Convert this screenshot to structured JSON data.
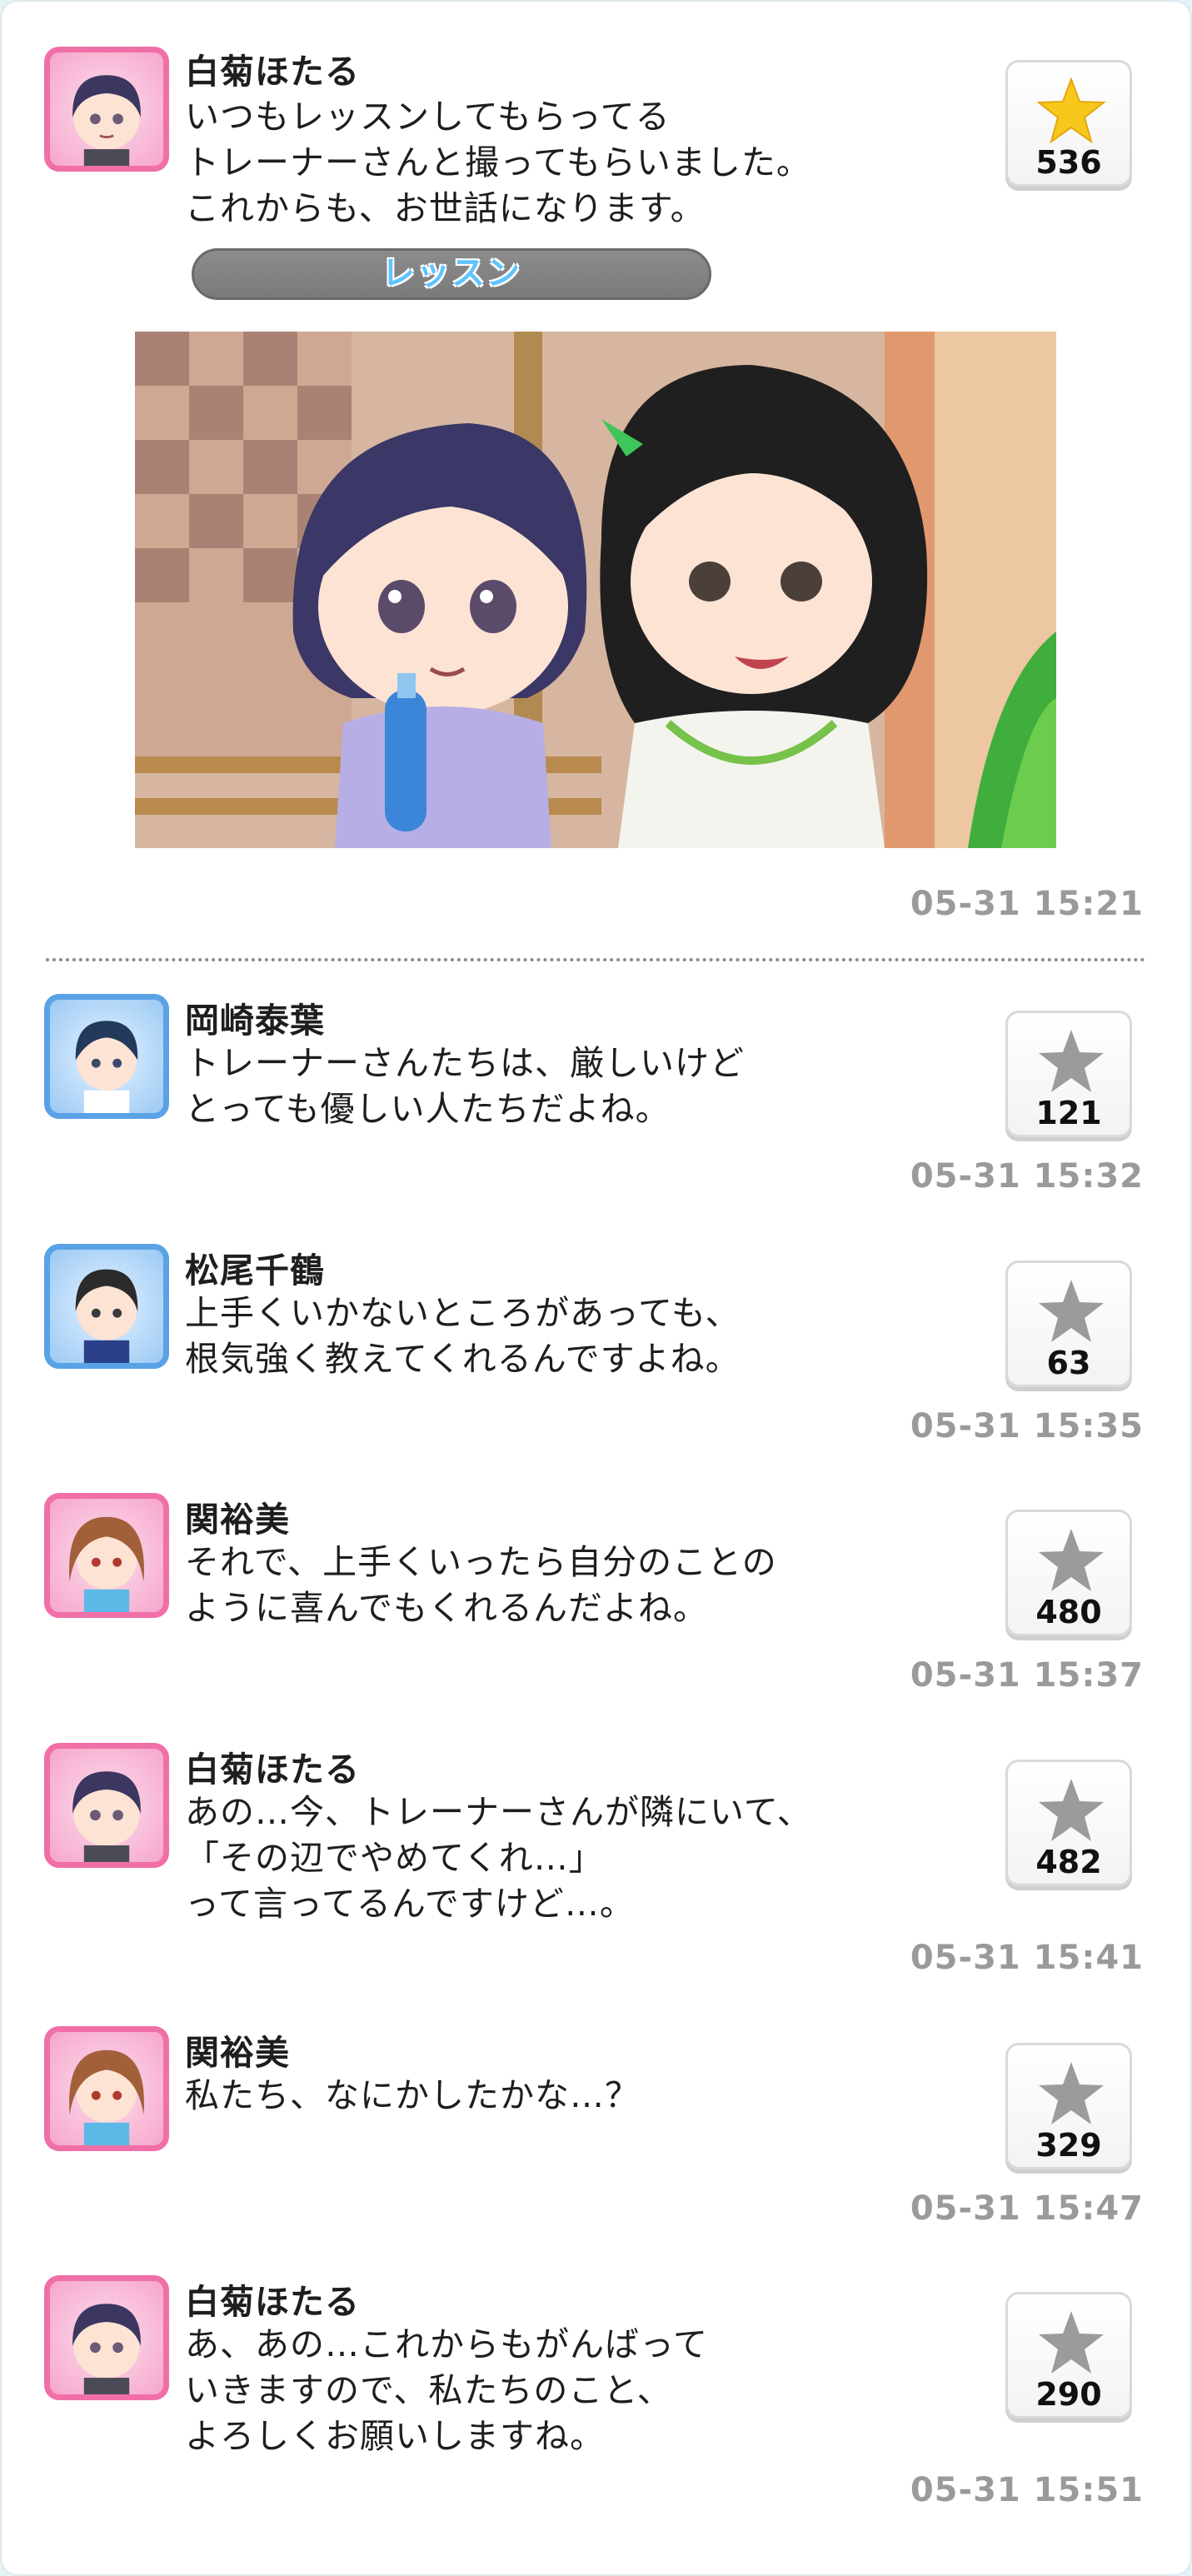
{
  "posts": [
    {
      "author": "白菊ほたる",
      "text": "いつもレッスンしてもらってる\nトレーナーさんと撮ってもらいました。\nこれからも、お世話になります。",
      "tag": "レッスン",
      "likes": "536",
      "liked": true,
      "time": "05-31 15:21"
    },
    {
      "author": "岡崎泰葉",
      "text": "トレーナーさんたちは、厳しいけど\nとっても優しい人たちだよね。",
      "likes": "121",
      "liked": false,
      "time": "05-31 15:32"
    },
    {
      "author": "松尾千鶴",
      "text": "上手くいかないところがあっても、\n根気強く教えてくれるんですよね。",
      "likes": "63",
      "liked": false,
      "time": "05-31 15:35"
    },
    {
      "author": "関裕美",
      "text": "それで、上手くいったら自分のことの\nように喜んでもくれるんだよね。",
      "likes": "480",
      "liked": false,
      "time": "05-31 15:37"
    },
    {
      "author": "白菊ほたる",
      "text": "あの…今、トレーナーさんが隣にいて、\n「その辺でやめてくれ…」\nって言ってるんですけど…。",
      "likes": "482",
      "liked": false,
      "time": "05-31 15:41"
    },
    {
      "author": "関裕美",
      "text": "私たち、なにかしたかな…？",
      "likes": "329",
      "liked": false,
      "time": "05-31 15:47"
    },
    {
      "author": "白菊ほたる",
      "text": "あ、あの…これからもがんばって\nいきますので、私たちのこと、\nよろしくお願いしますね。",
      "likes": "290",
      "liked": false,
      "time": "05-31 15:51"
    }
  ],
  "icons": {
    "liked_star_color": "#f7c81b",
    "unliked_star_color": "#9b9b9b",
    "tag_text_color": "#5fc3ff"
  }
}
